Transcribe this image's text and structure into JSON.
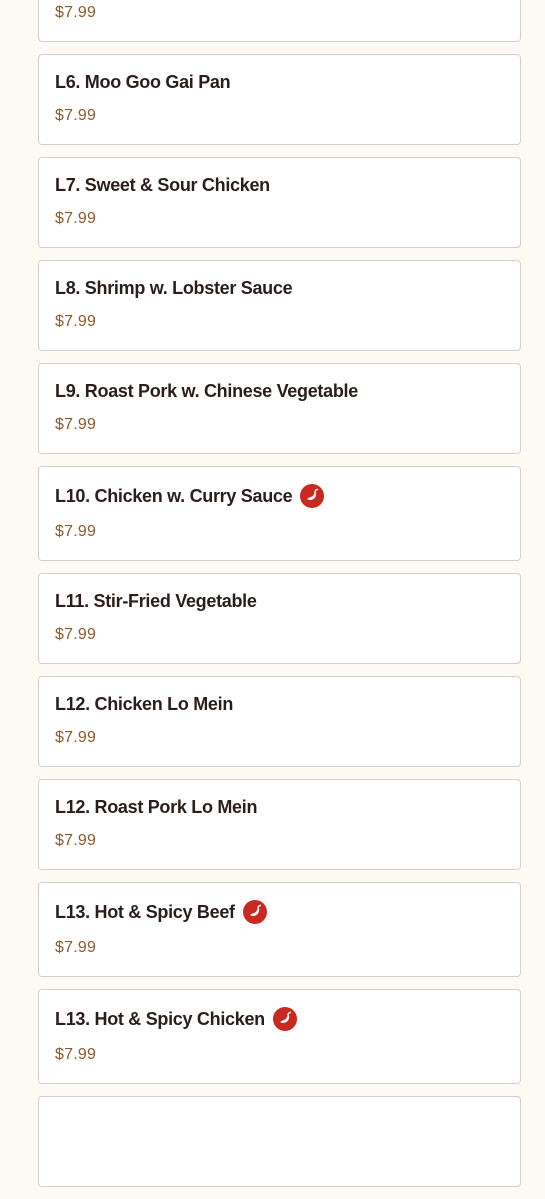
{
  "colors": {
    "background": "#fdfaf4",
    "card_border": "#d4d0cb",
    "item_name": "#2b1e1a",
    "price": "#8a5a2b",
    "spicy_badge": "#c82a22"
  },
  "menu": {
    "items": [
      {
        "name": "",
        "price": "$7.99",
        "spicy": false
      },
      {
        "name": "L6. Moo Goo Gai Pan",
        "price": "$7.99",
        "spicy": false
      },
      {
        "name": "L7. Sweet & Sour Chicken",
        "price": "$7.99",
        "spicy": false
      },
      {
        "name": "L8. Shrimp w. Lobster Sauce",
        "price": "$7.99",
        "spicy": false
      },
      {
        "name": "L9. Roast Pork w. Chinese Vegetable",
        "price": "$7.99",
        "spicy": false
      },
      {
        "name": "L10. Chicken w. Curry Sauce",
        "price": "$7.99",
        "spicy": true,
        "icon": "hot-pepper-icon"
      },
      {
        "name": "L11. Stir-Fried Vegetable",
        "price": "$7.99",
        "spicy": false
      },
      {
        "name": "L12. Chicken Lo Mein",
        "price": "$7.99",
        "spicy": false
      },
      {
        "name": "L12. Roast Pork Lo Mein",
        "price": "$7.99",
        "spicy": false
      },
      {
        "name": "L13. Hot & Spicy Beef",
        "price": "$7.99",
        "spicy": true,
        "icon": "hot-pepper-icon"
      },
      {
        "name": "L13. Hot & Spicy Chicken",
        "price": "$7.99",
        "spicy": true,
        "icon": "hot-pepper-icon"
      },
      {
        "name": "",
        "price": "",
        "spicy": false
      }
    ]
  }
}
